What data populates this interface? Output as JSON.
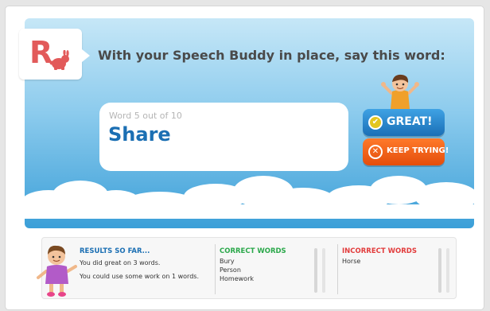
{
  "prompt": "With your Speech Buddy in place, say this word:",
  "logo": {
    "letter": "R"
  },
  "card": {
    "counter": "Word 5 out of 10",
    "word": "Share"
  },
  "buttons": {
    "great": "GREAT!",
    "keep_trying": "KEEP TRYING!"
  },
  "results": {
    "title": "RESULTS SO FAR...",
    "line1": "You did great on 3 words.",
    "line2": "You could use some work on 1 words."
  },
  "correct": {
    "title": "CORRECT WORDS",
    "words": [
      "Bury",
      "Person",
      "Homework"
    ]
  },
  "incorrect": {
    "title": "INCORRECT WORDS",
    "words": [
      "Horse"
    ]
  },
  "colors": {
    "correct": "#2aa84a",
    "incorrect": "#e23b3b",
    "results": "#1b6fb3",
    "great_button": "#1a6fb6",
    "keep_button": "#f0601a"
  }
}
